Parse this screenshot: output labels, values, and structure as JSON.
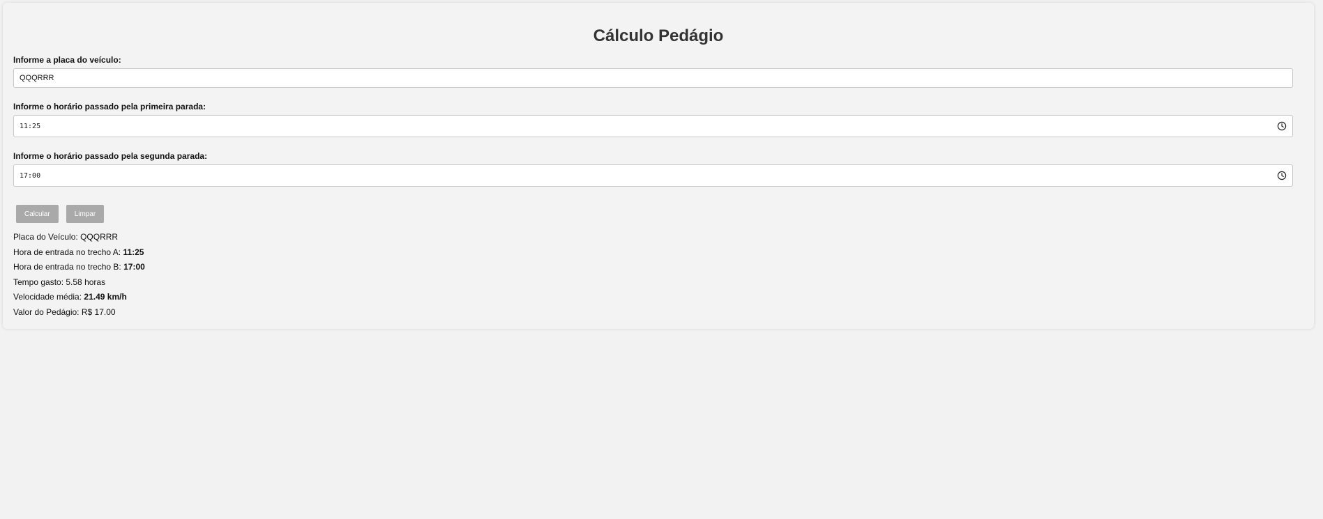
{
  "page": {
    "title": "Cálculo Pedágio"
  },
  "form": {
    "plate_label": "Informe a placa do veículo:",
    "plate_value": "QQQRRR",
    "first_stop_label": "Informe o horário passado pela primeira parada:",
    "first_stop_value": "11:25",
    "second_stop_label": "Informe o horário passado pela segunda parada:",
    "second_stop_value": "17:00",
    "clock_icon": "clock-icon"
  },
  "buttons": {
    "calculate_label": "Calcular",
    "clear_label": "Limpar",
    "color": "#a9a9a9"
  },
  "results": {
    "plate_label": "Placa do Veículo: ",
    "plate_value": "QQQRRR",
    "entry_a_label": "Hora de entrada no trecho A: ",
    "entry_a_value": "11:25",
    "entry_b_label": "Hora de entrada no trecho B: ",
    "entry_b_value": "17:00",
    "time_spent_label": "Tempo gasto: ",
    "time_spent_value": "5.58 horas",
    "avg_speed_label": "Velocidade média: ",
    "avg_speed_value": "21.49 km/h",
    "toll_label": "Valor do Pedágio: ",
    "toll_value": "R$ 17.00"
  }
}
